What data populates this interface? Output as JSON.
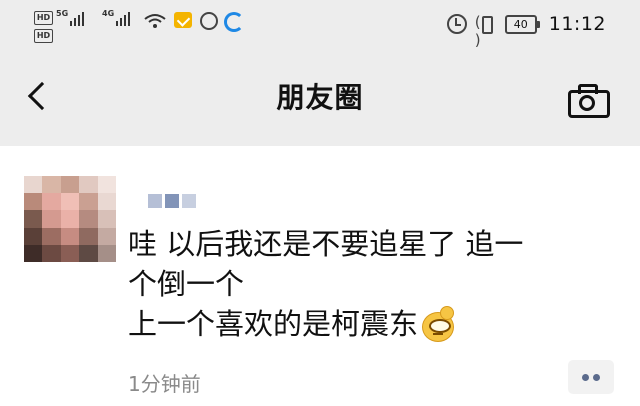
{
  "status_bar": {
    "hd_badge": "HD",
    "network_1": "5G",
    "network_2": "4G",
    "battery": "40",
    "time": "11:12",
    "icons": [
      "hd-icon",
      "signal-icon",
      "wifi-icon",
      "app-notification-icon",
      "alarm-icon",
      "vibrate-icon",
      "battery-icon"
    ]
  },
  "navbar": {
    "title": "朋友圈",
    "icons": [
      "back-icon",
      "camera-icon"
    ]
  },
  "post": {
    "text_lines": [
      "哇 以后我还是不要追星了 追一",
      "个倒一个",
      "上一个喜欢的是柯震东"
    ],
    "emoji": "sweat-smile-emoji",
    "time": "1分钟前",
    "more_icon": "more-dots-icon",
    "colors": {
      "time_text": "#8a8a8a",
      "more_dots": "#5b6b8c"
    }
  }
}
